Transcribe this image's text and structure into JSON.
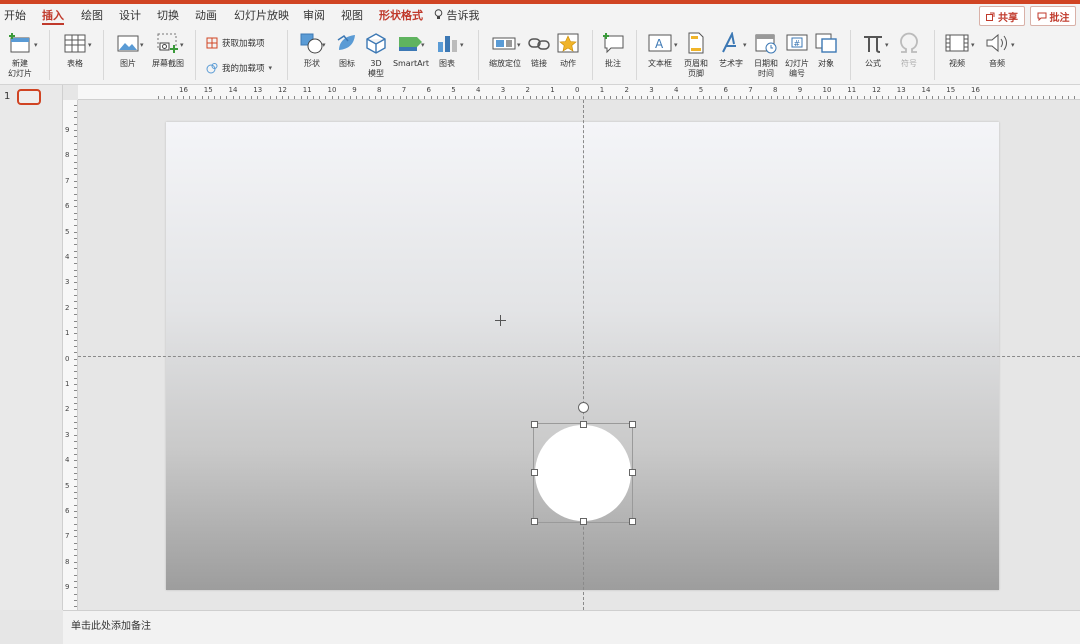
{
  "tabs": [
    "开始",
    "插入",
    "绘图",
    "设计",
    "切换",
    "动画",
    "幻灯片放映",
    "审阅",
    "视图",
    "形状格式",
    "告诉我"
  ],
  "active_tab": "插入",
  "share_label": "共享",
  "comment_label": "批注",
  "toolbar": {
    "new_slide": "新建\n幻灯片",
    "table": "表格",
    "picture": "图片",
    "screenshot": "屏幕截图",
    "get_addins": "获取加载项",
    "my_addins": "我的加载项",
    "shapes": "形状",
    "icons": "图标",
    "model3d": "3D\n模型",
    "smartart": "SmartArt",
    "chart": "图表",
    "zoom": "缩放定位",
    "link": "链接",
    "action": "动作",
    "comment": "批注",
    "textbox": "文本框",
    "header_footer": "页眉和\n页脚",
    "wordart": "艺术字",
    "datetime": "日期和\n时间",
    "slide_number": "幻灯片\n编号",
    "object": "对象",
    "equation": "公式",
    "symbol": "符号",
    "video": "视频",
    "audio": "音频"
  },
  "slide_panel": {
    "slide_number": "1"
  },
  "notes_placeholder": "单击此处添加备注",
  "hruler_labels": [
    "16",
    "15",
    "14",
    "13",
    "12",
    "11",
    "10",
    "9",
    "8",
    "7",
    "6",
    "5",
    "4",
    "3",
    "2",
    "1",
    "0",
    "1",
    "2",
    "3",
    "4",
    "5",
    "6",
    "7",
    "8",
    "9",
    "10",
    "11",
    "12",
    "13",
    "14",
    "15",
    "16"
  ],
  "vruler_labels": [
    "9",
    "8",
    "7",
    "6",
    "5",
    "4",
    "3",
    "2",
    "1",
    "0",
    "1",
    "2",
    "3",
    "4",
    "5",
    "6",
    "7",
    "8",
    "9"
  ],
  "colors": {
    "accent": "#c0392b",
    "topbar": "#d04423"
  }
}
